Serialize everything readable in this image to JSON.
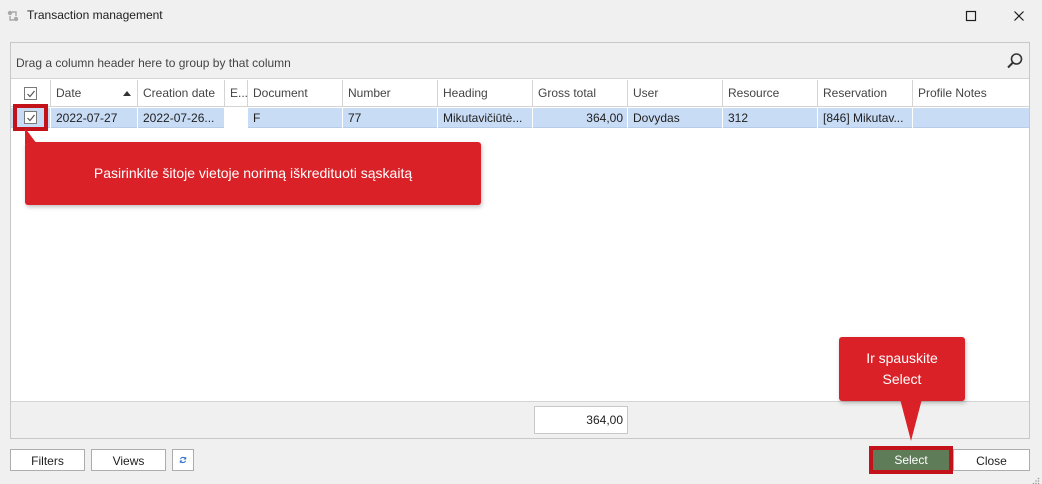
{
  "window": {
    "title": "Transaction management",
    "icon": "app-transaction-icon"
  },
  "grid": {
    "group_hint": "Drag a column header here to group by that column",
    "columns": [
      "Date",
      "Creation date",
      "E...",
      "Document",
      "Number",
      "Heading",
      "Gross total",
      "User",
      "Resource",
      "Reservation",
      "Profile Notes"
    ],
    "rows": [
      {
        "checked": true,
        "date": "2022-07-27",
        "creation_date": "2022-07-26...",
        "e": "",
        "document": "F",
        "number": "77",
        "heading": "Mikutavičiūtė...",
        "gross_total": "364,00",
        "user": "Dovydas",
        "resource": "312",
        "reservation": "[846] Mikutav...",
        "profile_notes": ""
      }
    ],
    "footer_total": "364,00"
  },
  "buttons": {
    "filters": "Filters",
    "views": "Views",
    "select": "Select",
    "close": "Close"
  },
  "annotations": {
    "callout_row": "Pasirinkite šitoje vietoje norimą iškredituoti sąskaitą",
    "callout_select_line1": "Ir spauskite",
    "callout_select_line2": "Select"
  },
  "colors": {
    "selection_row": "#c9dcf5",
    "callout_red": "#da2128",
    "select_button": "#5f7c59"
  }
}
